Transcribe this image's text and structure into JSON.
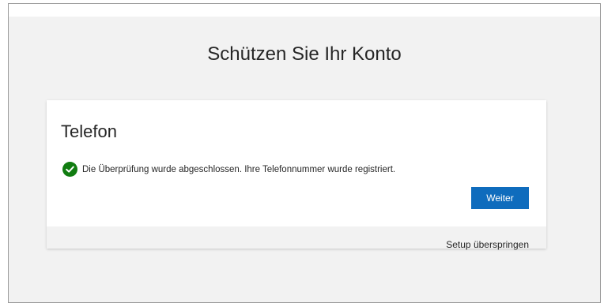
{
  "page": {
    "title": "Schützen Sie Ihr Konto"
  },
  "card": {
    "title": "Telefon",
    "status_message": "Die Überprüfung wurde abgeschlossen. Ihre Telefonnummer wurde registriert.",
    "status_icon": "check-circle-icon",
    "next_button_label": "Weiter",
    "skip_link_label": "Setup überspringen"
  },
  "colors": {
    "accent": "#0f6cbd",
    "success": "#107c10",
    "background": "#f2f2f2"
  }
}
